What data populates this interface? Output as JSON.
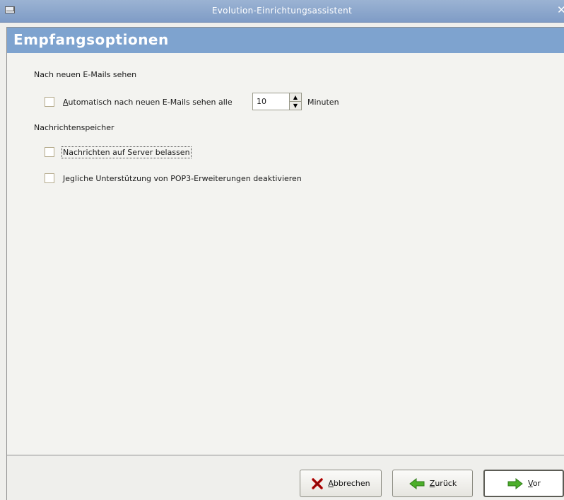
{
  "window": {
    "title": "Evolution-Einrichtungsassistent"
  },
  "page": {
    "title": "Empfangsoptionen"
  },
  "check_mail": {
    "section_label": "Nach neuen E-Mails sehen",
    "auto_check": {
      "checked": false,
      "label_mnemonic": "A",
      "label_rest": "utomatisch nach neuen E-Mails sehen alle"
    },
    "interval_value": "10",
    "interval_unit": "Minuten"
  },
  "storage": {
    "section_label": "Nachrichtenspeicher",
    "leave_on_server": {
      "checked": false,
      "label": "Nachrichten auf Server belassen"
    },
    "disable_pop3_ext": {
      "checked": false,
      "label": "Jegliche Unterstützung von POP3-Erweiterungen deaktivieren"
    }
  },
  "buttons": {
    "cancel": {
      "mnemonic": "A",
      "rest": "bbrechen"
    },
    "back": {
      "mnemonic": "Z",
      "rest": "urück"
    },
    "forward": {
      "mnemonic": "V",
      "rest": "or"
    }
  },
  "colors": {
    "titlebar": "#8aa7cd",
    "header": "#7ea3cf",
    "arrow_green": "#4caf2a",
    "cancel_red": "#c40000"
  },
  "icons": [
    "envelope-icon",
    "close-icon",
    "cancel-x-icon",
    "back-arrow-icon",
    "forward-arrow-icon",
    "spin-up-icon",
    "spin-down-icon"
  ]
}
